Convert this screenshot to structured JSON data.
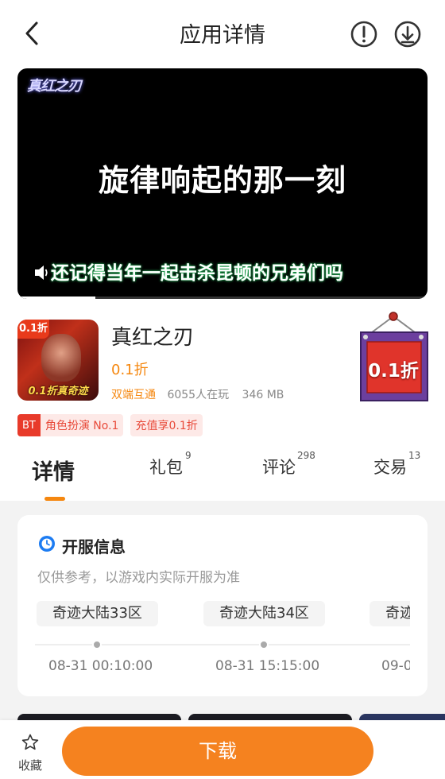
{
  "header": {
    "title": "应用详情"
  },
  "video": {
    "logo_text": "真红之刃",
    "headline": "旋律响起的那一刻",
    "subtitle": "还记得当年一起击杀昆顿的兄弟们吗",
    "progress_fraction": 0.19
  },
  "app": {
    "icon_badge": "0.1折",
    "icon_caption": "0.1折真奇迹",
    "name": "真红之刃",
    "discount": "0.1折",
    "platform": "双端互通",
    "players": "6055人在玩",
    "size": "346 MB",
    "sign_text": "0.1折"
  },
  "tags": [
    {
      "prefix": "BT",
      "text": "角色扮演 No.1"
    },
    {
      "text": "充值享0.1折"
    }
  ],
  "tabs": [
    {
      "label": "详情",
      "count": ""
    },
    {
      "label": "礼包",
      "count": "9"
    },
    {
      "label": "评论",
      "count": "298"
    },
    {
      "label": "交易",
      "count": "13"
    }
  ],
  "server_info": {
    "title": "开服信息",
    "note": "仅供参考，以游戏内实际开服为准",
    "servers": [
      {
        "name": "奇迹大陆33区",
        "time": "08-31 00:10:00"
      },
      {
        "name": "奇迹大陆34区",
        "time": "08-31 15:15:00"
      },
      {
        "name": "奇迹",
        "time": "09-0"
      }
    ]
  },
  "bottom": {
    "favorite_label": "收藏",
    "download_label": "下载"
  },
  "colors": {
    "accent": "#f5821f",
    "tag_red": "#e83a2a"
  },
  "icons": [
    "back-icon",
    "report-icon",
    "download-manager-icon",
    "speaker-icon",
    "clock-icon",
    "star-icon"
  ]
}
